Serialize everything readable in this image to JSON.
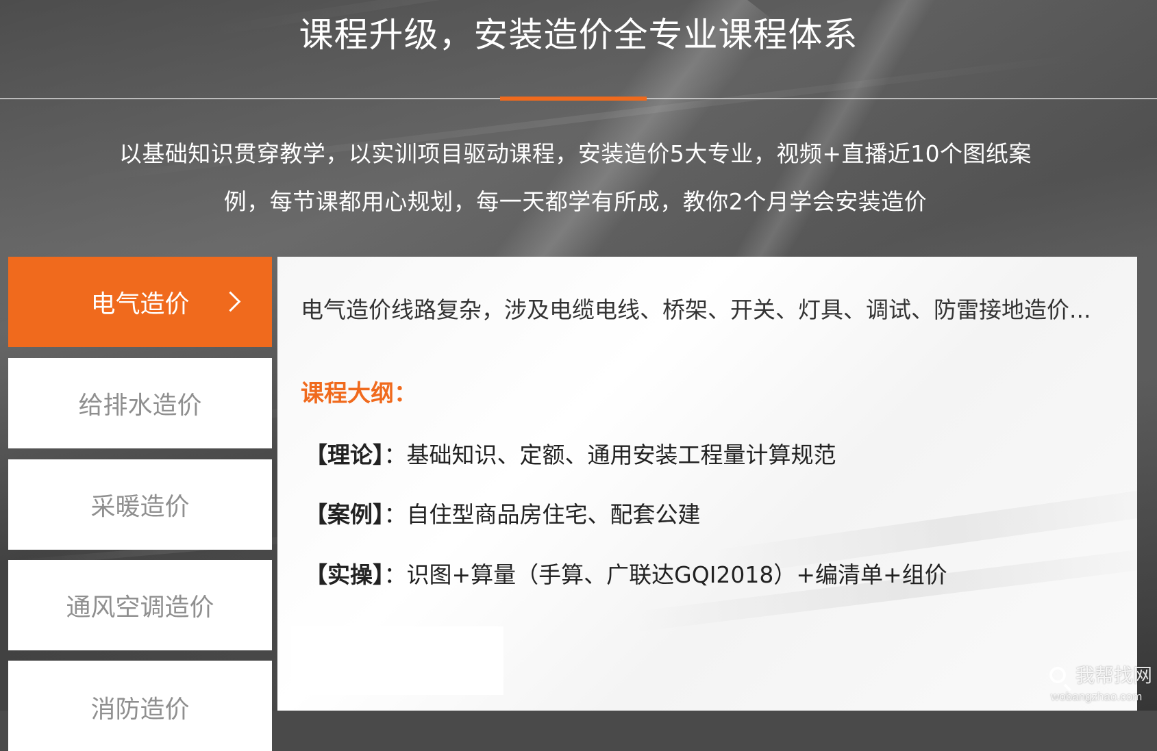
{
  "header": {
    "title": "课程升级，安装造价全专业课程体系",
    "intro_line1": "以基础知识贯穿教学，以实训项目驱动课程，安装造价5大专业，视频+直播近10个图纸案",
    "intro_line2": "例，每节课都用心规划，每一天都学有所成，教你2个月学会安装造价"
  },
  "tabs": [
    {
      "label": "电气造价",
      "active": true
    },
    {
      "label": "给排水造价",
      "active": false
    },
    {
      "label": "采暖造价",
      "active": false
    },
    {
      "label": "通风空调造价",
      "active": false
    },
    {
      "label": "消防造价",
      "active": false
    }
  ],
  "panel": {
    "description": "电气造价线路复杂，涉及电缆电线、桥架、开关、灯具、调试、防雷接地造价...",
    "outline_title": "课程大纲：",
    "outline": [
      {
        "label": "【理论】",
        "text": "：基础知识、定额、通用安装工程量计算规范"
      },
      {
        "label": "【案例】",
        "text": "：自住型商品房住宅、配套公建"
      },
      {
        "label": "【实操】",
        "text": "：识图+算量（手算、广联达GQI2018）+编清单+组价"
      }
    ]
  },
  "watermark": {
    "name": "我帮找网",
    "url": "wobangzhao.com"
  },
  "colors": {
    "accent": "#f06a1d",
    "background": "#4a4a4a",
    "panel": "#ffffff",
    "tab_inactive_text": "#8f8f8f"
  },
  "icons": {
    "active_tab_indicator": "chevron-right-icon",
    "watermark_logo": "search-icon"
  }
}
